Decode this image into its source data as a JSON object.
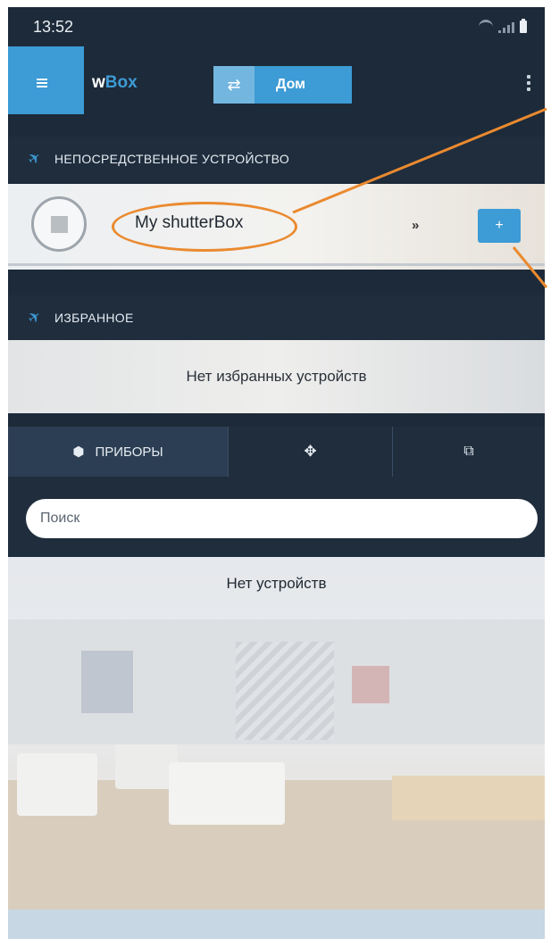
{
  "status_bar": {
    "time": "13:52"
  },
  "app_bar": {
    "brand_prefix": "w",
    "brand_accent": "Box",
    "home_label": "Дом"
  },
  "sections": {
    "direct_device": {
      "title": "НЕПОСРЕДСТВЕННОЕ УСТРОЙСТВО",
      "device_name": "My shutterBox",
      "more_label": "»",
      "add_label": "+"
    },
    "favorites": {
      "title": "ИЗБРАННОЕ",
      "empty_message": "Нет избранных устройств"
    }
  },
  "tabs": [
    {
      "label": "ПРИБОРЫ",
      "icon": "cube-icon",
      "active": true
    },
    {
      "label": "",
      "icon": "group-icon",
      "active": false
    },
    {
      "label": "",
      "icon": "scenes-icon",
      "active": false
    }
  ],
  "search": {
    "placeholder": "Поиск"
  },
  "devices": {
    "empty_message": "Нет устройств"
  },
  "colors": {
    "accent": "#3d9bd5",
    "header_bg": "#1f2d3d",
    "annotation": "#ea8a2f"
  }
}
